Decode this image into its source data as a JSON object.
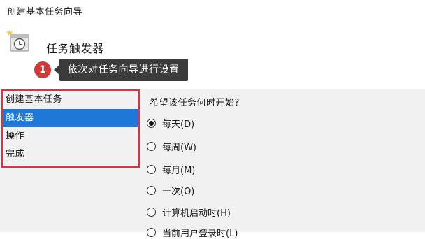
{
  "window": {
    "title": "创建基本任务向导"
  },
  "header": {
    "icon": "clock-task-icon",
    "heading": "任务触发器"
  },
  "callout": {
    "number": "1",
    "text": "依次对任务向导进行设置",
    "color": "#d33838"
  },
  "sidebar": {
    "items": [
      {
        "label": "创建基本任务",
        "selected": false
      },
      {
        "label": "触发器",
        "selected": true
      },
      {
        "label": "操作",
        "selected": false
      },
      {
        "label": "完成",
        "selected": false
      }
    ],
    "highlight_color": "#d9353c",
    "selected_color": "#1e78d7"
  },
  "trigger": {
    "prompt": "希望该任务何时开始?",
    "options": [
      {
        "label": "每天(D)",
        "checked": true
      },
      {
        "label": "每周(W)",
        "checked": false
      },
      {
        "label": "每月(M)",
        "checked": false
      },
      {
        "label": "一次(O)",
        "checked": false
      },
      {
        "label": "计算机启动时(H)",
        "checked": false
      },
      {
        "label": "当前用户登录时(L)",
        "checked": false
      }
    ]
  }
}
